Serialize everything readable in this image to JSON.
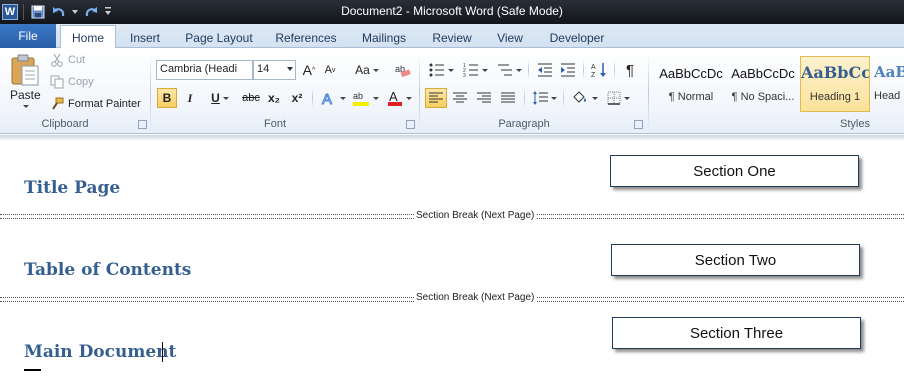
{
  "window": {
    "title": "Document2  -  Microsoft Word (Safe Mode)",
    "app_icon": "word-logo-icon",
    "app_letter": "W"
  },
  "tabs": [
    "File",
    "Home",
    "Insert",
    "Page Layout",
    "References",
    "Mailings",
    "Review",
    "View",
    "Developer"
  ],
  "active_tab": "Home",
  "ribbon": {
    "clipboard": {
      "label": "Clipboard",
      "paste": "Paste",
      "cut": "Cut",
      "copy": "Copy",
      "format_painter": "Format Painter"
    },
    "font": {
      "label": "Font",
      "font_name": "Cambria (Headi",
      "font_size": "14",
      "bold": "B",
      "italic": "I",
      "underline": "U",
      "strike": "abc",
      "subscript": "x₂",
      "superscript": "x²",
      "change_case": "Aa",
      "grow": "A",
      "shrink": "A"
    },
    "paragraph": {
      "label": "Paragraph",
      "pilcrow": "¶"
    },
    "styles": {
      "label": "Styles",
      "items": [
        {
          "sample": "AaBbCcDc",
          "name": "¶ Normal"
        },
        {
          "sample": "AaBbCcDc",
          "name": "¶ No Spaci..."
        },
        {
          "sample": "AaBbCс",
          "name": "Heading 1"
        },
        {
          "sample": "AaBb",
          "name": "Head"
        }
      ]
    }
  },
  "document": {
    "headings": [
      "Title Page",
      "Table of Contents",
      "Main Document"
    ],
    "section_break_label": "Section Break (Next Page)",
    "callouts": [
      "Section One",
      "Section Two",
      "Section Three"
    ]
  },
  "colors": {
    "heading": "#365f91",
    "file_tab": "#2a5fa8",
    "titlebar": "#12151b"
  }
}
